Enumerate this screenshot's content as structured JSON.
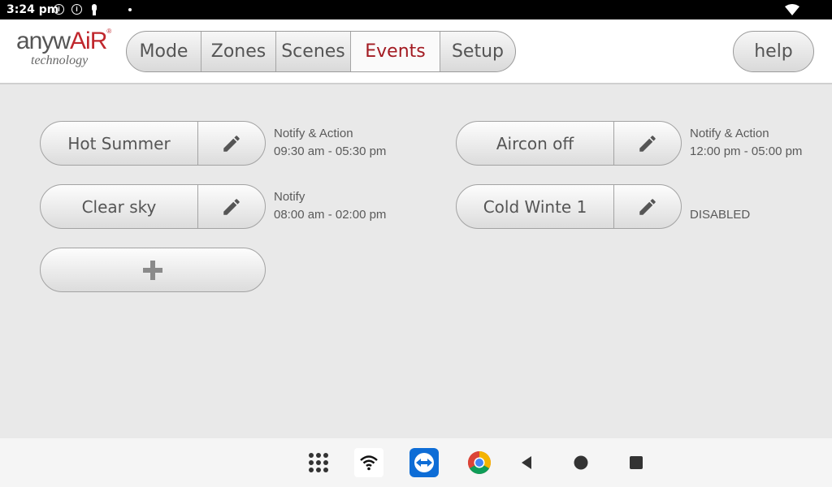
{
  "status_bar": {
    "time": "3:24 pm",
    "icons": [
      "info-icon",
      "info-icon",
      "lock-icon",
      "notification-dot-icon",
      "wifi-icon"
    ]
  },
  "logo": {
    "brand_part1": "anyw",
    "brand_part2": "AiR",
    "registered": "®",
    "tagline": "technology"
  },
  "tabs": [
    {
      "label": "Mode"
    },
    {
      "label": "Zones"
    },
    {
      "label": "Scenes"
    },
    {
      "label": "Events",
      "active": true
    },
    {
      "label": "Setup"
    }
  ],
  "help_label": "help",
  "events": [
    {
      "name": "Hot Summer",
      "line1": "Notify & Action",
      "line2": "09:30 am - 05:30 pm"
    },
    {
      "name": "Aircon off",
      "line1": "Notify & Action",
      "line2": "12:00 pm - 05:00 pm"
    },
    {
      "name": "Clear sky",
      "line1": "Notify",
      "line2": "08:00 am - 02:00 pm"
    },
    {
      "name": "Cold Winte 1",
      "line1": "",
      "line2": "DISABLED"
    }
  ],
  "add_button_icon": "plus-icon",
  "nav_bar": {
    "icons": [
      "app-grid-icon",
      "wifi-app-icon",
      "teamviewer-icon",
      "chrome-icon",
      "back-icon",
      "home-icon",
      "recents-icon"
    ]
  },
  "colors": {
    "accent_active_tab": "#a31b22",
    "brand_red": "#c0272d",
    "background": "#e9e9e9"
  }
}
